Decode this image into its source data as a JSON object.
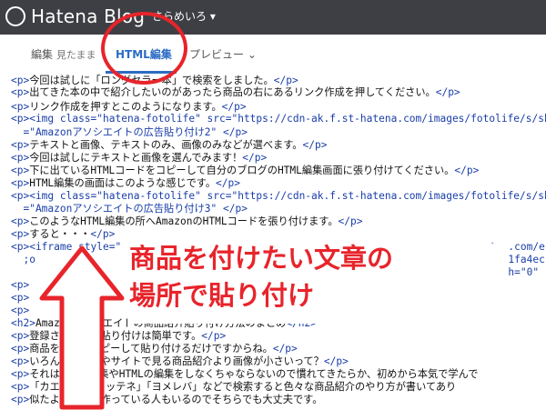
{
  "header": {
    "logo_text": "Hatena Blog",
    "user_label": "さらめいろ ▾"
  },
  "tabs": [
    {
      "label": "編集",
      "sub": "見たまま"
    },
    {
      "label": "HTML編集"
    },
    {
      "label": "プレビュー ⌄"
    }
  ],
  "code_lines": [
    {
      "tag_open": "<p>",
      "text": "今回は試しに「ロングセラー本」で検索をしました。",
      "tag_close": "</p>"
    },
    {
      "tag_open": "<p>",
      "text": "出てきた本の中で紹介したいのがあったら商品の右にあるリンク作成を押してください。",
      "tag_close": "</p>"
    },
    {
      "tag_open": "<p>",
      "text": "リンク作成を押すとこのようになります。",
      "tag_close": "</p>"
    },
    {
      "tag_open": "<p><img class=\"hatena-fotolife\" src=\"https://cdn-ak.f.st-hatena.com/images/fotolife/s/she",
      "text": "",
      "tag_close": ""
    },
    {
      "tag_open": "  =\"Amazonアソシエイトの広告貼り付け2\" </p>",
      "text": "",
      "tag_close": ""
    },
    {
      "tag_open": "<p>",
      "text": "テキストと画像、テキストのみ、画像のみなどが選べます。",
      "tag_close": "</p>"
    },
    {
      "tag_open": "<p>",
      "text": "今回は試しにテキストと画像を選んでみます！",
      "tag_close": "</p>"
    },
    {
      "tag_open": "<p>",
      "text": "下に出ているHTMLコードをコピーして自分のブログのHTML編集画面に張り付けてください。",
      "tag_close": "</p>"
    },
    {
      "tag_open": "<p>",
      "text": "HTML編集の画面はこのような感じです。",
      "tag_close": "</p>"
    },
    {
      "tag_open": "<p><img class=\"hatena-fotolife\" src=\"https://cdn-ak.f.st-hatena.com/images/fotolife/s/she",
      "text": "",
      "tag_close": ""
    },
    {
      "tag_open": "  =\"Amazonアソシエイトの広告貼り付け3\" </p>",
      "text": "",
      "tag_close": ""
    },
    {
      "tag_open": "<p>",
      "text": "このようなHTML編集の所へAmazonのHTMLコードを張り付けます。",
      "tag_close": "</p>"
    },
    {
      "tag_open": "<p>",
      "text": "すると・・・",
      "tag_close": "</p>"
    },
    {
      "tag_open": "<p><iframe style=\"",
      "text": "",
      "tag_close": "system.com/e"
    },
    {
      "tag_open": "  ;o",
      "text": "",
      "tag_close": "nkId=e1fa4ec"
    },
    {
      "tag_open": "  ",
      "text": "",
      "tag_close": "inwidth=\"0\""
    },
    {
      "tag_open": "<p>",
      "text": "",
      "tag_close": ""
    },
    {
      "tag_open": "<p>",
      "text": "",
      "tag_close": ""
    },
    {
      "tag_open": "<p>",
      "text": "",
      "tag_close": ""
    },
    {
      "tag_open": "<h2>",
      "text": "Amazonアソシエイトの商品紹介貼り付け方法のまとめ",
      "tag_close": "</h2>"
    },
    {
      "tag_open": "<p>",
      "text": "登録さえすれば貼り付けは簡単です。",
      "tag_close": "</p>"
    },
    {
      "tag_open": "<p>",
      "text": "商品を選んでコピーして貼り付けるだけですからね。",
      "tag_close": "</p>"
    },
    {
      "tag_open": "<p>",
      "text": "いろんなブログやサイトで見る商品紹介より画像が小さいって？",
      "tag_close": "</p>"
    },
    {
      "tag_open": "<p>",
      "text": "それはCSSの編集やHTMLの編集をしなくちゃならないので慣れてきたらか、初めから本気で学んで",
      "tag_close": ""
    },
    {
      "tag_open": "<p>",
      "text": "「カエレバ」「カッテネ」「ヨメレバ」などで検索すると色々な商品紹介のやり方が書いてあり",
      "tag_close": ""
    },
    {
      "tag_open": "<p>",
      "text": "似たようなのを作っている人もいるのでそちらでも大丈夫です。",
      "tag_close": ""
    }
  ],
  "annotation": {
    "line1": "商品を付けたい文章の",
    "line2": "場所で貼り付け",
    "color": "#e8242b"
  }
}
